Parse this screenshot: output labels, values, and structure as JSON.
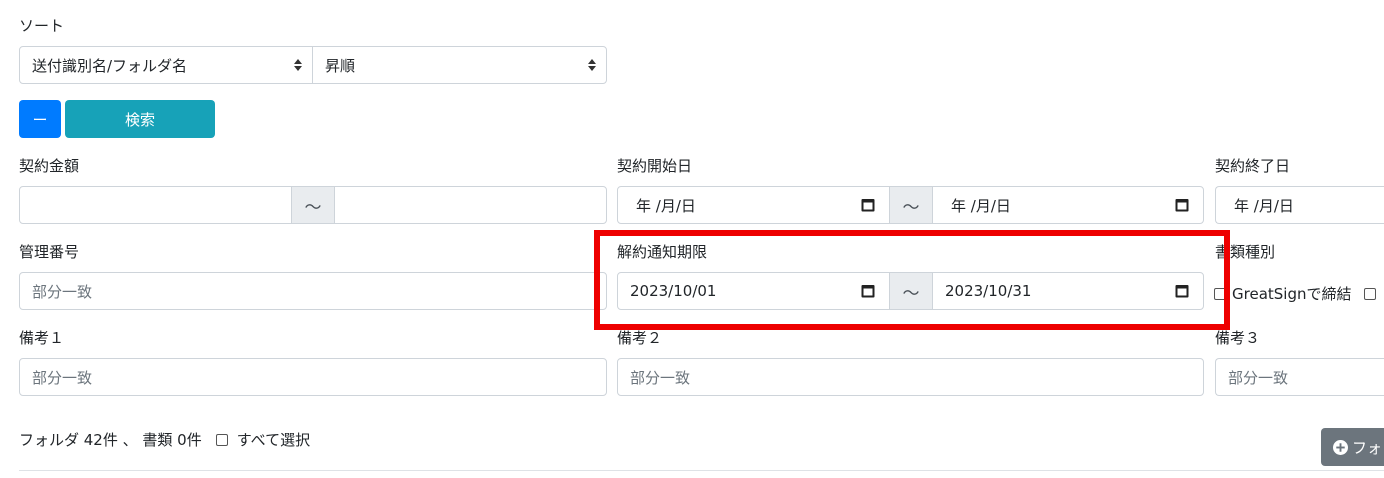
{
  "sort": {
    "label": "ソート",
    "field_value": "送付識別名/フォルダ名",
    "order_value": "昇順"
  },
  "buttons": {
    "collapse": "ー",
    "search": "検索",
    "add_folder_partial": "フォ"
  },
  "filters": {
    "contract_amount": {
      "label": "契約金額",
      "separator": "～"
    },
    "contract_start": {
      "label": "契約開始日",
      "from_placeholder": "年 /月/日",
      "to_placeholder": "年 /月/日",
      "separator": "～"
    },
    "contract_end": {
      "label": "契約終了日",
      "from_placeholder": "年 /月/日"
    },
    "management_no": {
      "label": "管理番号",
      "placeholder": "部分一致"
    },
    "cancel_notice": {
      "label": "解約通知期限",
      "from_value": "2023/10/01",
      "to_value": "2023/10/31",
      "separator": "～"
    },
    "doc_type": {
      "label": "書類種別",
      "option1": "GreatSignで締結"
    },
    "note1": {
      "label": "備考１",
      "placeholder": "部分一致"
    },
    "note2": {
      "label": "備考２",
      "placeholder": "部分一致"
    },
    "note3": {
      "label": "備考３",
      "placeholder": "部分一致"
    }
  },
  "summary": {
    "text": "フォルダ 42件 、 書類 0件",
    "select_all": "すべて選択"
  },
  "colors": {
    "primary": "#007bff",
    "info": "#17a2b8",
    "highlight": "#ee0000"
  }
}
